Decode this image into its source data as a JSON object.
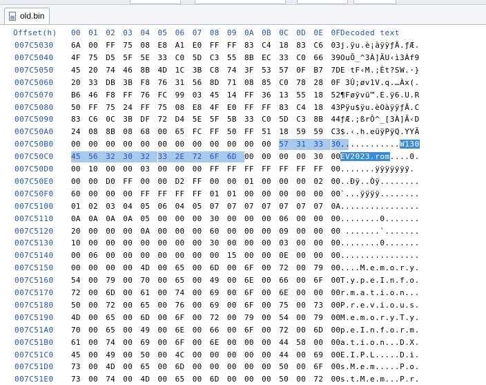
{
  "tab": {
    "label": "old.bin",
    "icon": "binary-file-icon"
  },
  "header": {
    "offset_label": "Offset(h)",
    "columns": [
      "00",
      "01",
      "02",
      "03",
      "04",
      "05",
      "06",
      "07",
      "08",
      "09",
      "0A",
      "0B",
      "0C",
      "0D",
      "0E",
      "0F"
    ],
    "decoded_label": "Decoded text"
  },
  "rows": [
    {
      "offset": "007C5030",
      "bytes": [
        "6A",
        "00",
        "FF",
        "75",
        "08",
        "E8",
        "A1",
        "E0",
        "FF",
        "FF",
        "83",
        "C4",
        "18",
        "83",
        "C6",
        "03"
      ],
      "text": "j.ÿu.è¡àÿÿƒÄ.ƒÆ."
    },
    {
      "offset": "007C5040",
      "bytes": [
        "4F",
        "75",
        "D5",
        "5F",
        "5E",
        "33",
        "C0",
        "5D",
        "C3",
        "55",
        "8B",
        "EC",
        "33",
        "C0",
        "66",
        "39"
      ],
      "text": "OuÕ_^3À]ÃU‹ì3Àf9"
    },
    {
      "offset": "007C5050",
      "bytes": [
        "45",
        "20",
        "74",
        "46",
        "8B",
        "4D",
        "1C",
        "3B",
        "C8",
        "74",
        "3F",
        "53",
        "57",
        "0F",
        "B7",
        "7D"
      ],
      "text": "E tF‹M.;Èt?SW.·}"
    },
    {
      "offset": "007C5060",
      "bytes": [
        "20",
        "33",
        "DB",
        "3B",
        "F8",
        "76",
        "31",
        "56",
        "8D",
        "71",
        "08",
        "85",
        "C0",
        "78",
        "28",
        "0F"
      ],
      "text": " 3Û;øv1V.q.…Àx(."
    },
    {
      "offset": "007C5070",
      "bytes": [
        "B6",
        "46",
        "F8",
        "FF",
        "76",
        "FC",
        "99",
        "03",
        "45",
        "14",
        "FF",
        "36",
        "13",
        "55",
        "18",
        "52"
      ],
      "text": "¶Føÿvü™.E.ÿ6.U.R"
    },
    {
      "offset": "007C5080",
      "bytes": [
        "50",
        "FF",
        "75",
        "24",
        "FF",
        "75",
        "08",
        "E8",
        "4F",
        "E0",
        "FF",
        "FF",
        "83",
        "C4",
        "18",
        "43"
      ],
      "text": "Pÿu$ÿu.èOàÿÿƒÄ.C"
    },
    {
      "offset": "007C5090",
      "bytes": [
        "83",
        "C6",
        "0C",
        "3B",
        "DF",
        "72",
        "D4",
        "5E",
        "5F",
        "5B",
        "33",
        "C0",
        "5D",
        "C3",
        "8B",
        "44"
      ],
      "text": "ƒÆ.;ßrÔ^_[3À]Ã‹D"
    },
    {
      "offset": "007C50A0",
      "bytes": [
        "24",
        "08",
        "8B",
        "08",
        "68",
        "00",
        "65",
        "FC",
        "FF",
        "50",
        "FF",
        "51",
        "18",
        "59",
        "59",
        "C3"
      ],
      "text": "$.‹.h.eüÿPÿQ.YYÃ"
    },
    {
      "offset": "007C50B0",
      "bytes": [
        "00",
        "00",
        "00",
        "00",
        "00",
        "00",
        "00",
        "00",
        "00",
        "00",
        "00",
        "00",
        "57",
        "31",
        "33",
        "30"
      ],
      "text": "............W130"
    },
    {
      "offset": "007C50C0",
      "bytes": [
        "45",
        "56",
        "32",
        "30",
        "32",
        "33",
        "2E",
        "72",
        "6F",
        "6D",
        "00",
        "00",
        "00",
        "00",
        "30",
        "00"
      ],
      "text": "EV2023.rom....0."
    },
    {
      "offset": "007C50D0",
      "bytes": [
        "00",
        "10",
        "00",
        "00",
        "03",
        "00",
        "00",
        "00",
        "FF",
        "FF",
        "FF",
        "FF",
        "FF",
        "FF",
        "FF",
        "00"
      ],
      "text": ".......ÿÿÿÿÿÿÿ."
    },
    {
      "offset": "007C50E0",
      "bytes": [
        "00",
        "00",
        "D0",
        "FF",
        "00",
        "00",
        "D2",
        "FF",
        "00",
        "00",
        "01",
        "00",
        "00",
        "00",
        "02",
        "00"
      ],
      "text": "..Ðÿ..Òÿ........"
    },
    {
      "offset": "007C50F0",
      "bytes": [
        "60",
        "00",
        "00",
        "00",
        "FF",
        "FF",
        "FF",
        "FF",
        "01",
        "01",
        "00",
        "00",
        "00",
        "00",
        "00",
        "00"
      ],
      "text": "`...ÿÿÿÿ........"
    },
    {
      "offset": "007C5100",
      "bytes": [
        "01",
        "02",
        "03",
        "04",
        "05",
        "06",
        "04",
        "05",
        "07",
        "07",
        "07",
        "07",
        "07",
        "07",
        "07",
        "0A"
      ],
      "text": "................"
    },
    {
      "offset": "007C5110",
      "bytes": [
        "0A",
        "0A",
        "0A",
        "0A",
        "05",
        "00",
        "00",
        "00",
        "30",
        "00",
        "00",
        "00",
        "06",
        "00",
        "00",
        "00"
      ],
      "text": "........0......."
    },
    {
      "offset": "007C5120",
      "bytes": [
        "20",
        "00",
        "00",
        "00",
        "0A",
        "00",
        "00",
        "00",
        "60",
        "00",
        "00",
        "00",
        "09",
        "00",
        "00",
        "00"
      ],
      "text": " .......`......."
    },
    {
      "offset": "007C5130",
      "bytes": [
        "10",
        "00",
        "00",
        "00",
        "00",
        "00",
        "00",
        "00",
        "30",
        "00",
        "00",
        "00",
        "03",
        "00",
        "00",
        "00"
      ],
      "text": "........0......."
    },
    {
      "offset": "007C5140",
      "bytes": [
        "00",
        "06",
        "00",
        "00",
        "00",
        "00",
        "00",
        "00",
        "00",
        "15",
        "00",
        "00",
        "0E",
        "00",
        "00",
        "00"
      ],
      "text": "................"
    },
    {
      "offset": "007C5150",
      "bytes": [
        "00",
        "00",
        "00",
        "00",
        "4D",
        "00",
        "65",
        "00",
        "6D",
        "00",
        "6F",
        "00",
        "72",
        "00",
        "79",
        "00"
      ],
      "text": "....M.e.m.o.r.y."
    },
    {
      "offset": "007C5160",
      "bytes": [
        "54",
        "00",
        "79",
        "00",
        "70",
        "00",
        "65",
        "00",
        "49",
        "00",
        "6E",
        "00",
        "66",
        "00",
        "6F",
        "00"
      ],
      "text": "T.y.p.e.I.n.f.o."
    },
    {
      "offset": "007C5170",
      "bytes": [
        "72",
        "00",
        "6D",
        "00",
        "61",
        "00",
        "74",
        "00",
        "69",
        "00",
        "6F",
        "00",
        "6E",
        "00",
        "00",
        "00"
      ],
      "text": "r.m.a.t.i.o.n..."
    },
    {
      "offset": "007C5180",
      "bytes": [
        "50",
        "00",
        "72",
        "00",
        "65",
        "00",
        "76",
        "00",
        "69",
        "00",
        "6F",
        "00",
        "75",
        "00",
        "73",
        "00"
      ],
      "text": "P.r.e.v.i.o.u.s."
    },
    {
      "offset": "007C5190",
      "bytes": [
        "4D",
        "00",
        "65",
        "00",
        "6D",
        "00",
        "6F",
        "00",
        "72",
        "00",
        "79",
        "00",
        "54",
        "00",
        "79",
        "00"
      ],
      "text": "M.e.m.o.r.y.T.y."
    },
    {
      "offset": "007C51A0",
      "bytes": [
        "70",
        "00",
        "65",
        "00",
        "49",
        "00",
        "6E",
        "00",
        "66",
        "00",
        "6F",
        "00",
        "72",
        "00",
        "6D",
        "00"
      ],
      "text": "p.e.I.n.f.o.r.m."
    },
    {
      "offset": "007C51B0",
      "bytes": [
        "61",
        "00",
        "74",
        "00",
        "69",
        "00",
        "6F",
        "00",
        "6E",
        "00",
        "00",
        "00",
        "44",
        "58",
        "00",
        "00"
      ],
      "text": "a.t.i.o.n...D.X."
    },
    {
      "offset": "007C51C0",
      "bytes": [
        "45",
        "00",
        "49",
        "00",
        "50",
        "00",
        "4C",
        "00",
        "00",
        "00",
        "00",
        "00",
        "44",
        "00",
        "69",
        "00"
      ],
      "text": "E.I.P.L.....D.i."
    },
    {
      "offset": "007C51D0",
      "bytes": [
        "73",
        "00",
        "4D",
        "00",
        "65",
        "00",
        "6D",
        "00",
        "00",
        "00",
        "00",
        "00",
        "50",
        "00",
        "6F",
        "00"
      ],
      "text": "s.M.e.m.....P.o."
    },
    {
      "offset": "007C51E0",
      "bytes": [
        "73",
        "00",
        "74",
        "00",
        "4D",
        "00",
        "65",
        "00",
        "6D",
        "00",
        "00",
        "00",
        "50",
        "00",
        "72",
        "00"
      ],
      "text": "s.t.M.e.m...P.r."
    }
  ],
  "selection": {
    "row_start": 8,
    "col_start": 12,
    "row_end": 9,
    "col_end": 9,
    "text_part1": "W130",
    "text_part2": "EV2023.rom"
  },
  "colors": {
    "offset": "#1f52c6",
    "selection_bg": "#a8c9ec",
    "decoded_selection_bg": "#3a8be0"
  }
}
